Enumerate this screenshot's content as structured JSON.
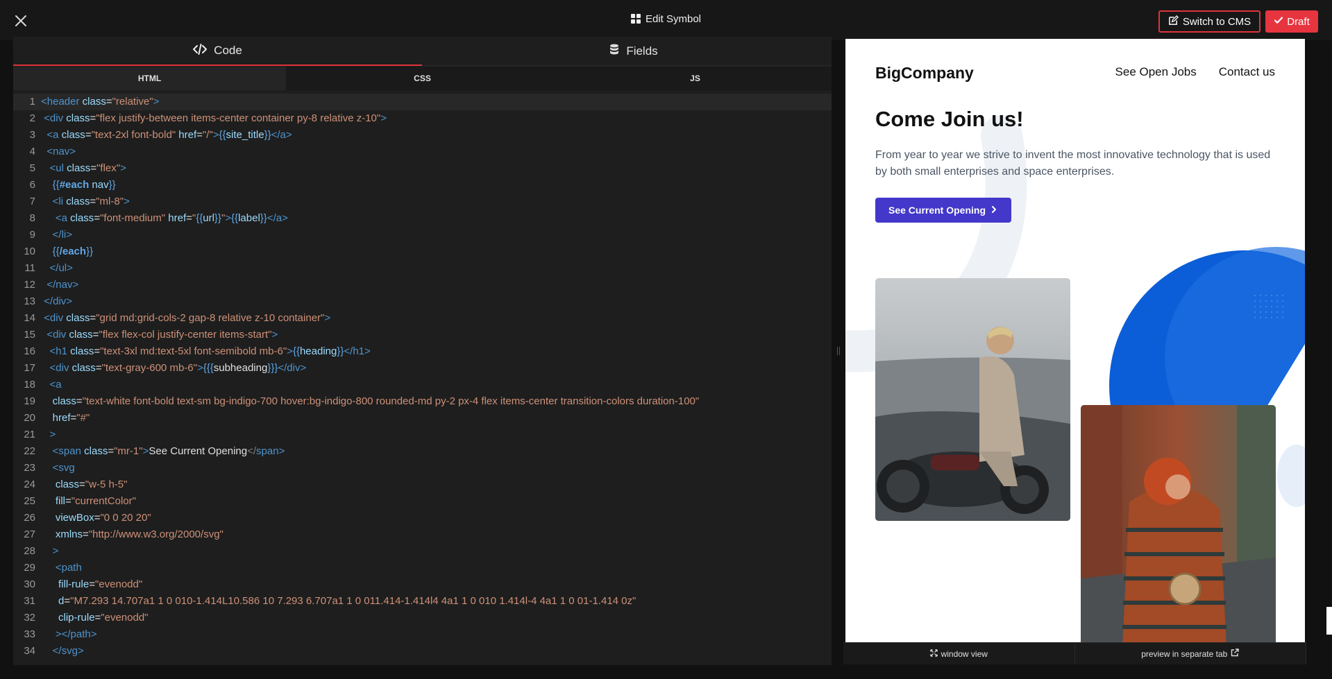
{
  "topbar": {
    "title": "Edit Symbol",
    "switch_label": "Switch to CMS",
    "draft_label": "Draft"
  },
  "editor": {
    "tabs": [
      {
        "label": "Code"
      },
      {
        "label": "Fields"
      }
    ],
    "subtabs": [
      {
        "label": "HTML"
      },
      {
        "label": "CSS"
      },
      {
        "label": "JS"
      }
    ],
    "active_subtab": "HTML"
  },
  "code_lines": [
    {
      "n": "1",
      "html": "<span class='t'>&lt;header</span> <span class='a'>class</span><span class='m'>=</span><span class='s'>\"relative\"</span><span class='t'>&gt;</span>"
    },
    {
      "n": "2",
      "html": " <span class='t'>&lt;div</span> <span class='a'>class</span><span class='m'>=</span><span class='s'>\"flex justify-between items-center container py-8 relative z-10\"</span><span class='t'>&gt;</span>"
    },
    {
      "n": "3",
      "html": "  <span class='t'>&lt;a</span> <span class='a'>class</span><span class='m'>=</span><span class='s'>\"text-2xl font-bold\"</span> <span class='a'>href</span><span class='m'>=</span><span class='s'>\"/\"</span><span class='t'>&gt;</span><span class='h'>{{</span><span class='a'>site_title</span><span class='h'>}}</span><span class='t'>&lt;/a&gt;</span>"
    },
    {
      "n": "4",
      "html": "  <span class='t'>&lt;nav&gt;</span>"
    },
    {
      "n": "5",
      "html": "   <span class='t'>&lt;ul</span> <span class='a'>class</span><span class='m'>=</span><span class='s'>\"flex\"</span><span class='t'>&gt;</span>"
    },
    {
      "n": "6",
      "html": "    <span class='h'>{{</span><span class='hb'>#each</span> <span class='a'>nav</span><span class='h'>}}</span>"
    },
    {
      "n": "7",
      "html": "    <span class='t'>&lt;li</span> <span class='a'>class</span><span class='m'>=</span><span class='s'>\"ml-8\"</span><span class='t'>&gt;</span>"
    },
    {
      "n": "8",
      "html": "     <span class='t'>&lt;a</span> <span class='a'>class</span><span class='m'>=</span><span class='s'>\"font-medium\"</span> <span class='a'>href</span><span class='m'>=</span><span class='s'>\"</span><span class='h'>{{</span><span class='a'>url</span><span class='h'>}}</span><span class='s'>\"</span><span class='t'>&gt;</span><span class='h'>{{</span><span class='a'>label</span><span class='h'>}}</span><span class='t'>&lt;/a&gt;</span>"
    },
    {
      "n": "9",
      "html": "    <span class='t'>&lt;/li&gt;</span>"
    },
    {
      "n": "10",
      "html": "    <span class='h'>{{</span><span class='hb'>/each</span><span class='h'>}}</span>"
    },
    {
      "n": "11",
      "html": "   <span class='t'>&lt;/ul&gt;</span>"
    },
    {
      "n": "12",
      "html": "  <span class='t'>&lt;/nav&gt;</span>"
    },
    {
      "n": "13",
      "html": " <span class='t'>&lt;/div&gt;</span>"
    },
    {
      "n": "14",
      "html": " <span class='t'>&lt;div</span> <span class='a'>class</span><span class='m'>=</span><span class='s'>\"grid md:grid-cols-2 gap-8 relative z-10 container\"</span><span class='t'>&gt;</span>"
    },
    {
      "n": "15",
      "html": "  <span class='t'>&lt;div</span> <span class='a'>class</span><span class='m'>=</span><span class='s'>\"flex flex-col justify-center items-start\"</span><span class='t'>&gt;</span>"
    },
    {
      "n": "16",
      "html": "   <span class='t'>&lt;h1</span> <span class='a'>class</span><span class='m'>=</span><span class='s'>\"text-3xl md:text-5xl font-semibold mb-6\"</span><span class='t'>&gt;</span><span class='h'>{{</span><span class='a'>heading</span><span class='h'>}}</span><span class='t'>&lt;/h1&gt;</span>"
    },
    {
      "n": "17",
      "html": "   <span class='t'>&lt;div</span> <span class='a'>class</span><span class='m'>=</span><span class='s'>\"text-gray-600 mb-6\"</span><span class='t'>&gt;</span><span class='h'>{{{</span><span class='m'>subheading</span><span class='h'>}}}</span><span class='t'>&lt;/div&gt;</span>"
    },
    {
      "n": "18",
      "html": "   <span class='t'>&lt;a</span>"
    },
    {
      "n": "19",
      "html": "    <span class='a'>class</span><span class='m'>=</span><span class='s'>\"text-white font-bold text-sm bg-indigo-700 hover:bg-indigo-800 rounded-md py-2 px-4 flex items-center transition-colors duration-100\"</span>"
    },
    {
      "n": "20",
      "html": "    <span class='a'>href</span><span class='m'>=</span><span class='s'>\"#\"</span>"
    },
    {
      "n": "21",
      "html": "   <span class='t'>&gt;</span>"
    },
    {
      "n": "22",
      "html": "    <span class='t'>&lt;span</span> <span class='a'>class</span><span class='m'>=</span><span class='s'>\"mr-1\"</span><span class='t'>&gt;</span><span class='m'>See Current Opening</span><span class='p'>&lt;/</span><span class='t'>span&gt;</span>"
    },
    {
      "n": "23",
      "html": "    <span class='t'>&lt;svg</span>"
    },
    {
      "n": "24",
      "html": "     <span class='a'>class</span><span class='m'>=</span><span class='s'>\"w-5 h-5\"</span>"
    },
    {
      "n": "25",
      "html": "     <span class='a'>fill</span><span class='m'>=</span><span class='s'>\"currentColor\"</span>"
    },
    {
      "n": "26",
      "html": "     <span class='a'>viewBox</span><span class='m'>=</span><span class='s'>\"0 0 20 20\"</span>"
    },
    {
      "n": "27",
      "html": "     <span class='a'>xmlns</span><span class='m'>=</span><span class='s'>\"http://www.w3.org/2000/svg\"</span>"
    },
    {
      "n": "28",
      "html": "    <span class='t'>&gt;</span>"
    },
    {
      "n": "29",
      "html": "     <span class='t'>&lt;path</span>"
    },
    {
      "n": "30",
      "html": "      <span class='a'>fill-rule</span><span class='m'>=</span><span class='s'>\"evenodd\"</span>"
    },
    {
      "n": "31",
      "html": "      <span class='a'>d</span><span class='m'>=</span><span class='s'>\"M7.293 14.707a1 1 0 010-1.414L10.586 10 7.293 6.707a1 1 0 011.414-1.414l4 4a1 1 0 010 1.414l-4 4a1 1 0 01-1.414 0z\"</span>"
    },
    {
      "n": "32",
      "html": "      <span class='a'>clip-rule</span><span class='m'>=</span><span class='s'>\"evenodd\"</span>"
    },
    {
      "n": "33",
      "html": "     <span class='t'>&gt;&lt;/path&gt;</span>"
    },
    {
      "n": "34",
      "html": "    <span class='t'>&lt;/svg&gt;</span>"
    }
  ],
  "preview": {
    "site_title": "BigCompany",
    "nav": [
      {
        "label": "See Open Jobs"
      },
      {
        "label": "Contact us"
      }
    ],
    "heading": "Come Join us!",
    "subheading": "From year to year we strive to invent the most innovative technology that is used by both small enterprises and space enterprises.",
    "cta_label": "See Current Opening"
  },
  "preview_footer": {
    "window_view": "window view",
    "separate_tab": "preview in separate tab"
  },
  "colors": {
    "accent": "#e0333c",
    "indigo": "#4338ca",
    "preview_blue": "#0b5ed7"
  }
}
